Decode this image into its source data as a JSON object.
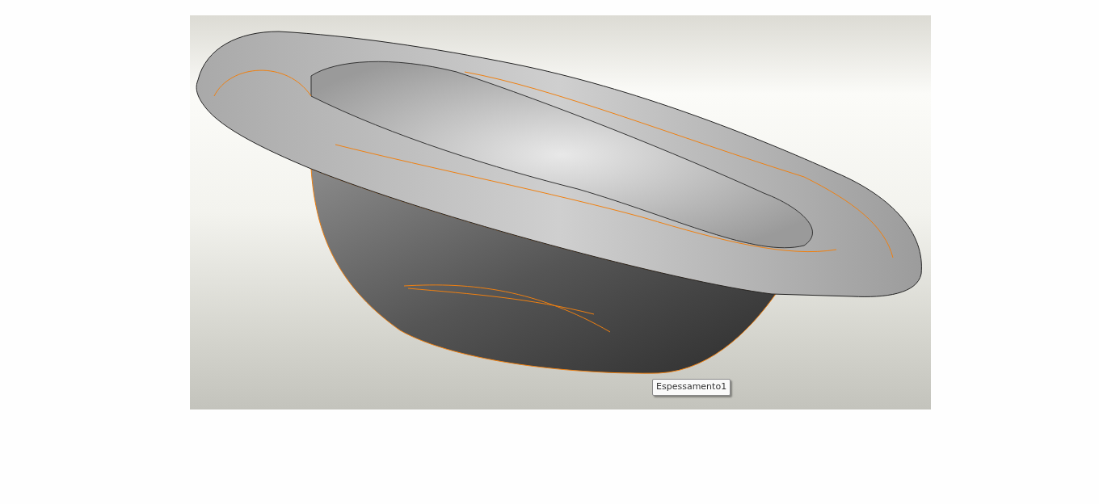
{
  "viewport": {
    "tooltip": "Espessamento1"
  }
}
